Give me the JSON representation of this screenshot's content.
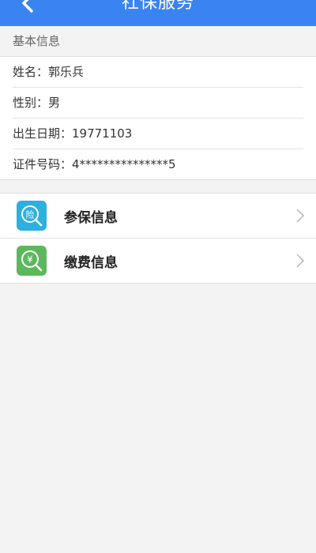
{
  "header": {
    "title": "社保服务"
  },
  "section": {
    "title": "基本信息"
  },
  "info": [
    {
      "text": "姓名：郭乐兵"
    },
    {
      "text": "性别：男"
    },
    {
      "text": "出生日期：19771103"
    },
    {
      "text": "证件号码：4***************5"
    }
  ],
  "menu": [
    {
      "label": "参保信息",
      "icon_char": "险",
      "icon": "insurance-search-icon",
      "color": "#2cb0e0"
    },
    {
      "label": "缴费信息",
      "icon_char": "¥",
      "icon": "payment-search-icon",
      "color": "#5cb85c"
    }
  ],
  "colors": {
    "header": "#3a84f1",
    "background": "#f3f3f3"
  }
}
